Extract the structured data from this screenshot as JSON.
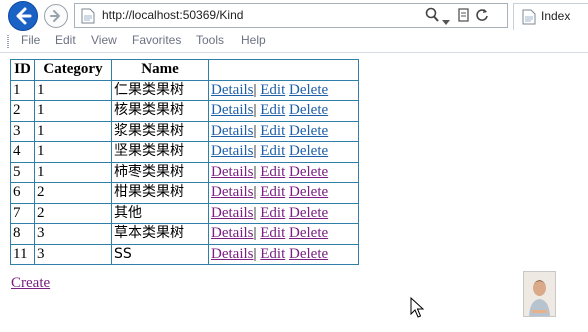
{
  "browser": {
    "url": "http://localhost:50369/Kind",
    "tab_title": "Index",
    "menu": [
      "File",
      "Edit",
      "View",
      "Favorites",
      "Tools",
      "Help"
    ]
  },
  "table": {
    "headers": [
      "ID",
      "Category",
      "Name",
      ""
    ],
    "rows": [
      {
        "id": "1",
        "category": "1",
        "name": "仁果类果树",
        "visited": false
      },
      {
        "id": "2",
        "category": "1",
        "name": "核果类果树",
        "visited": false
      },
      {
        "id": "3",
        "category": "1",
        "name": "浆果类果树",
        "visited": false
      },
      {
        "id": "4",
        "category": "1",
        "name": "坚果类果树",
        "visited": false
      },
      {
        "id": "5",
        "category": "1",
        "name": "柿枣类果树",
        "visited": true
      },
      {
        "id": "6",
        "category": "2",
        "name": "柑果类果树",
        "visited": true
      },
      {
        "id": "7",
        "category": "2",
        "name": "其他",
        "visited": true
      },
      {
        "id": "8",
        "category": "3",
        "name": "草本类果树",
        "visited": true
      },
      {
        "id": "11",
        "category": "3",
        "name": "SS",
        "visited": true
      }
    ],
    "actions": {
      "details": "Details",
      "separator": "|",
      "edit": "Edit",
      "delete": "Delete"
    }
  },
  "create_label": "Create",
  "colors": {
    "link": "#1f5fa8",
    "visited_link": "#7a1e82",
    "border": "#2f7fa8",
    "back_button": "#1b62c5"
  }
}
